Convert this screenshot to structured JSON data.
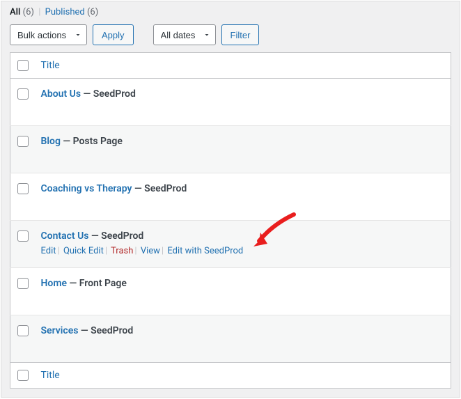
{
  "filters": {
    "all_label": "All",
    "all_count": "(6)",
    "published_label": "Published",
    "published_count": "(6)"
  },
  "bulk": {
    "select_label": "Bulk actions",
    "apply_label": "Apply"
  },
  "dates": {
    "select_label": "All dates",
    "filter_label": "Filter"
  },
  "columns": {
    "title": "Title"
  },
  "rows": [
    {
      "title": "About Us",
      "state": " — SeedProd"
    },
    {
      "title": "Blog",
      "state": " — Posts Page"
    },
    {
      "title": "Coaching vs Therapy",
      "state": " — SeedProd"
    },
    {
      "title": "Contact Us",
      "state": " — SeedProd",
      "actions": {
        "edit": "Edit",
        "quick_edit": "Quick Edit",
        "trash": "Trash",
        "view": "View",
        "edit_sp": "Edit with SeedProd"
      }
    },
    {
      "title": "Home",
      "state": " — Front Page"
    },
    {
      "title": "Services",
      "state": " — SeedProd"
    }
  ],
  "annotation": {
    "arrow_color": "#e91e1e"
  }
}
